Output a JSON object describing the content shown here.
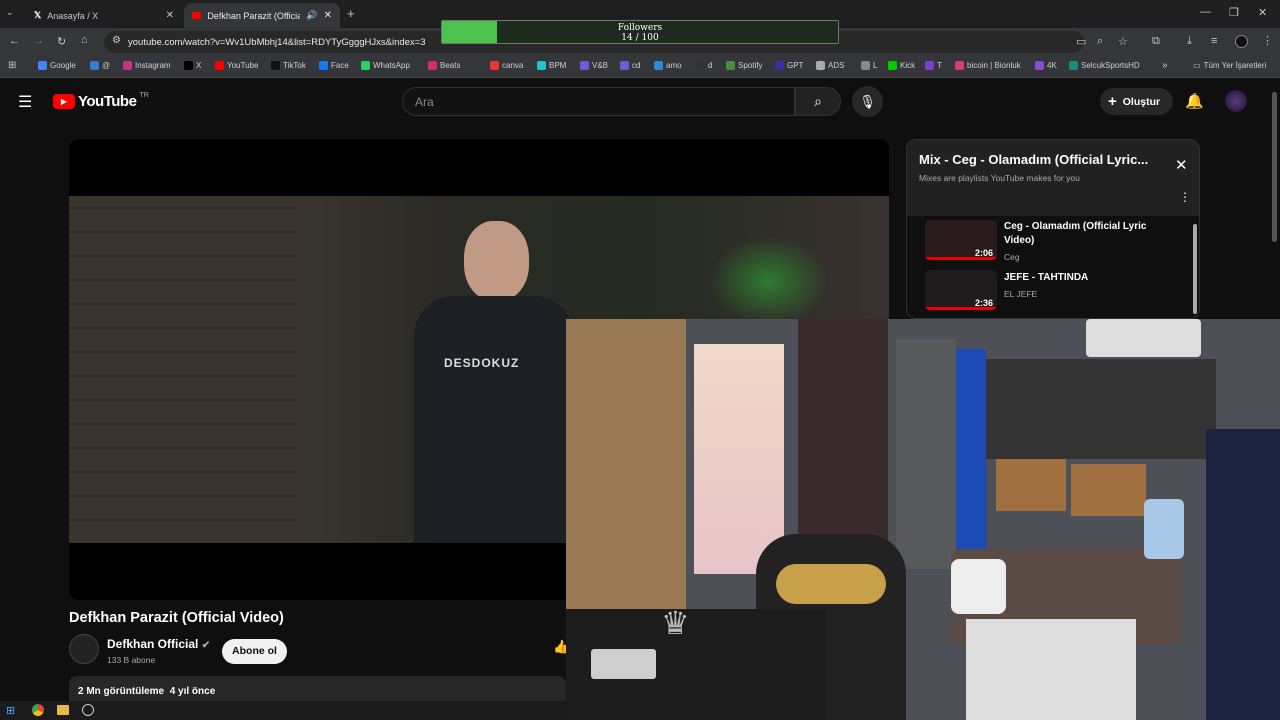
{
  "browser": {
    "tabs": [
      {
        "label": "Anasayfa / X",
        "icon": "x-logo-icon"
      },
      {
        "label": "Defkhan Parazit (Official Vi",
        "icon": "youtube-icon",
        "audio": true
      }
    ],
    "url": "youtube.com/watch?v=Wv1UbMbhj14&list=RDYTyGgggHJxs&index=3",
    "bookmarks": [
      "Google",
      "@",
      "Instagram",
      "X",
      "YouTube",
      "TikTok",
      "Face",
      "WhatsApp",
      "Beats",
      "canva",
      "BPM",
      "V&B",
      "cd",
      "amo",
      "d",
      "Spotify",
      "GPT",
      "ADS",
      "L",
      "Kick",
      "T",
      "bicoin | Bionluk",
      "4K",
      "SelcukSportsHD"
    ],
    "bookmark_folder": "Tüm Yer İşaretleri"
  },
  "overlay": {
    "title": "Followers",
    "current": 14,
    "total": 100,
    "text": "14 / 100",
    "fill_fraction": 0.14,
    "color": "#4ec24e"
  },
  "youtube": {
    "logo": "YouTube",
    "region": "TR",
    "search_placeholder": "Ara",
    "create_label": "Oluştur",
    "video_title": "Defkhan Parazit (Official Video)",
    "channel_name": "Defkhan Official",
    "subscribers": "133 B abone",
    "subscribe_label": "Abone ol",
    "views": "2 Mn görüntüleme",
    "age": "4 yıl önce",
    "shirt_text": "DESDOKUZ",
    "accent": "#ff0000"
  },
  "mix": {
    "title": "Mix - Ceg - Olamadım (Official Lyric...",
    "subtitle": "Mixes are playlists YouTube makes for you",
    "items": [
      {
        "title": "Ceg - Olamadım (Official Lyric Video)",
        "channel": "Ceg",
        "duration": "2:06"
      },
      {
        "title": "JEFE - TAHTINDA",
        "channel": "EL JEFE",
        "duration": "2:36"
      }
    ]
  }
}
